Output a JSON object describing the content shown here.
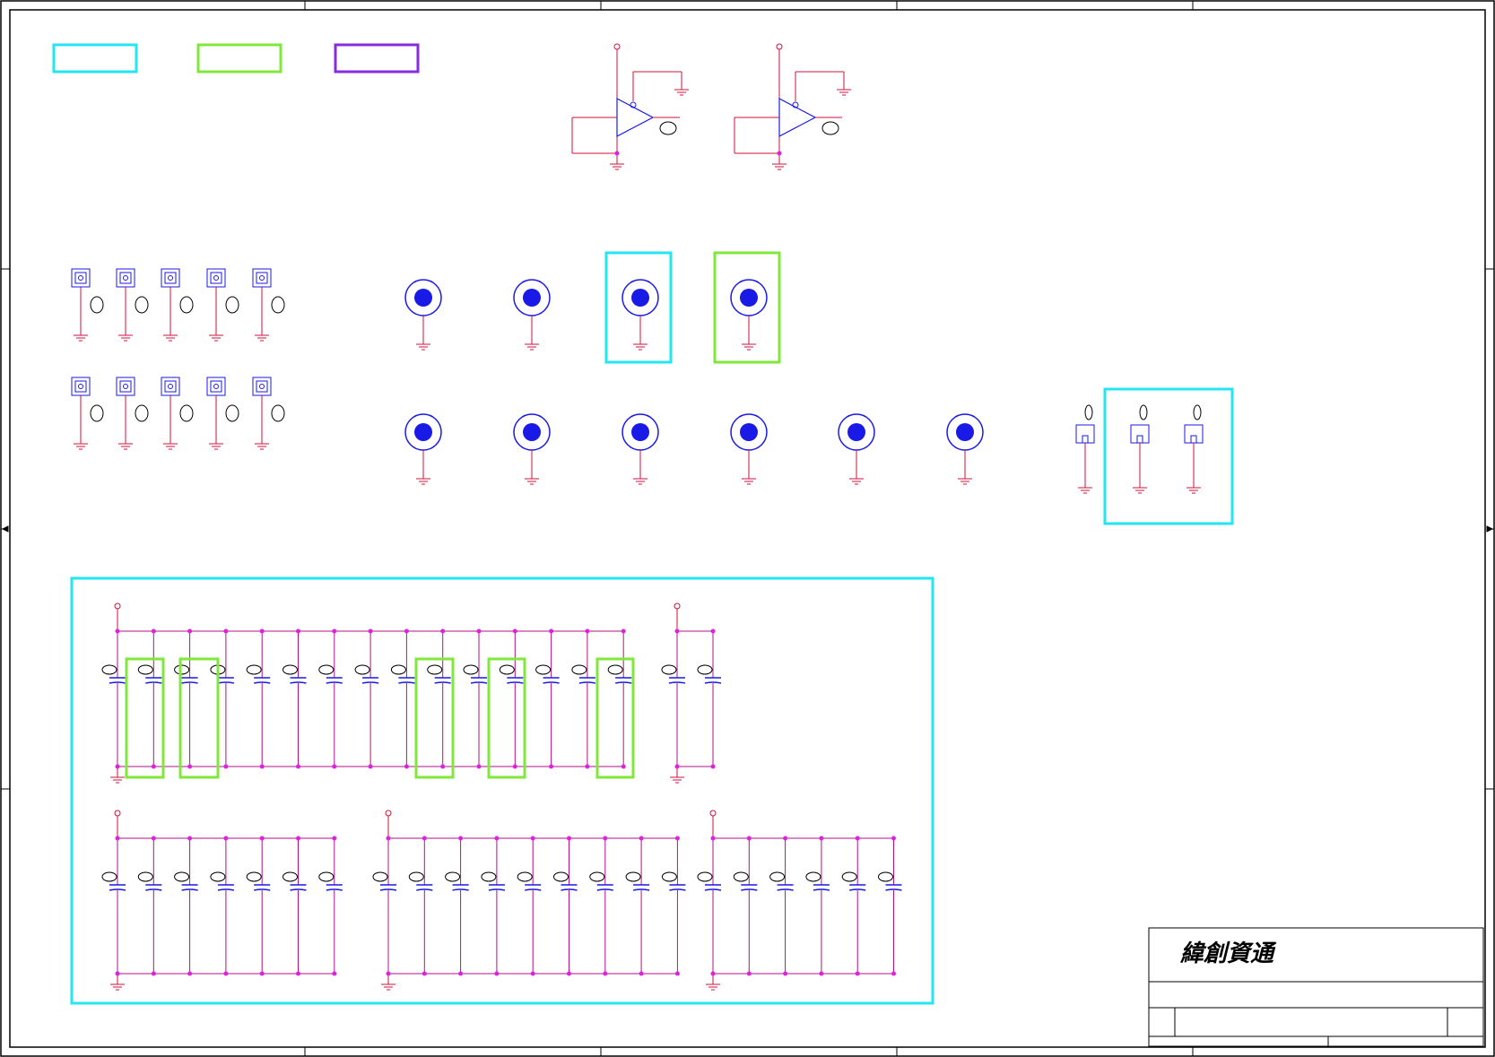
{
  "title_block": {
    "company": "緯創資通"
  },
  "colors": {
    "wire": "#d0103a",
    "component": "#1a1ae6",
    "net": "#b0108a",
    "junction": "#e020e0",
    "highlight_cyan": "#22e6f2",
    "highlight_green": "#7fe83a",
    "highlight_purple": "#8a2be2",
    "frame": "#000000"
  },
  "legend": [
    {
      "color": "cyan"
    },
    {
      "color": "green"
    },
    {
      "color": "purple"
    }
  ],
  "icons": [
    "ground-icon",
    "power-pin-icon",
    "buffer-gate-icon",
    "test-pad-icon",
    "mounting-hole-icon",
    "capacitor-icon",
    "connector-pin-icon"
  ]
}
